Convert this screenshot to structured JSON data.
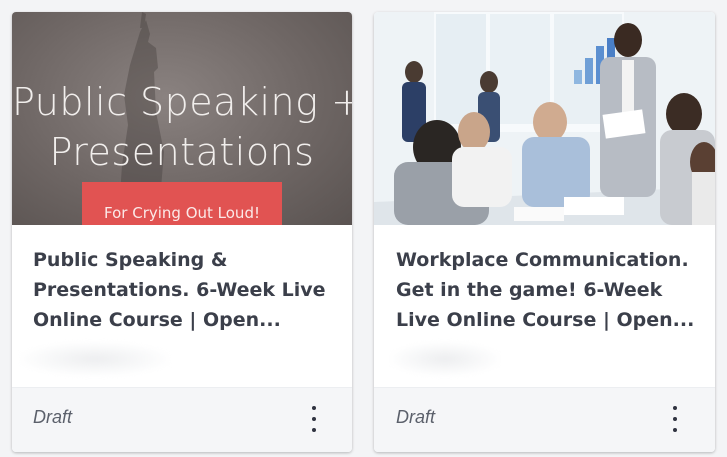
{
  "cards": [
    {
      "thumbnail": {
        "line1": "Public Speaking +",
        "line2": "Presentations",
        "ribbon": "For Crying Out Loud!"
      },
      "title": "Public Speaking & Presentations. 6-Week Live Online Course | Open...",
      "status": "Draft",
      "menu_icon": "more-vertical-icon"
    },
    {
      "thumbnail": {
        "description_icon": "office-meeting-photo"
      },
      "title": "Workplace Communication. Get in the game! 6-Week Live Online Course | Open...",
      "status": "Draft",
      "menu_icon": "more-vertical-icon"
    }
  ],
  "colors": {
    "ribbon": "#e15352",
    "title": "#3b3f4a",
    "footer_bg": "#f5f6f8"
  }
}
